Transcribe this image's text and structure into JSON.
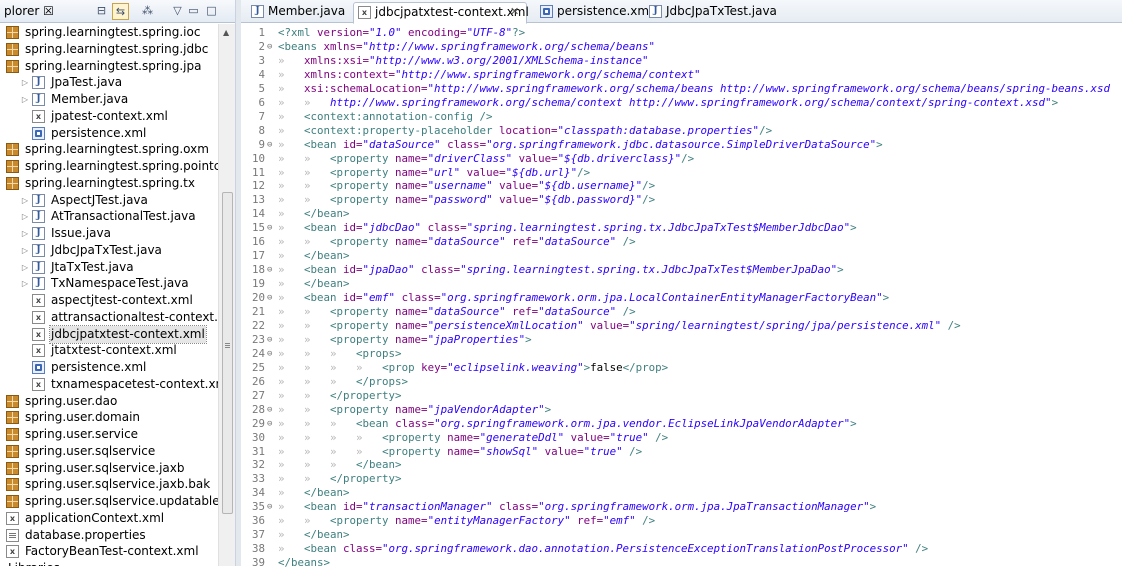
{
  "explorer": {
    "title": "plorer",
    "tree": [
      {
        "label": "spring.learningtest.spring.ioc",
        "type": "package",
        "twisty": ""
      },
      {
        "label": "spring.learningtest.spring.jdbc",
        "type": "package",
        "twisty": ""
      },
      {
        "label": "spring.learningtest.spring.jpa",
        "type": "package",
        "twisty": ""
      },
      {
        "label": "JpaTest.java",
        "type": "java",
        "twisty": "▷"
      },
      {
        "label": "Member.java",
        "type": "java",
        "twisty": "▷"
      },
      {
        "label": "jpatest-context.xml",
        "type": "xml",
        "twisty": ""
      },
      {
        "label": "persistence.xml",
        "type": "persistence",
        "twisty": ""
      },
      {
        "label": "spring.learningtest.spring.oxm",
        "type": "package",
        "twisty": ""
      },
      {
        "label": "spring.learningtest.spring.pointcut",
        "type": "package",
        "twisty": ""
      },
      {
        "label": "spring.learningtest.spring.tx",
        "type": "package",
        "twisty": ""
      },
      {
        "label": "AspectJTest.java",
        "type": "java",
        "twisty": "▷"
      },
      {
        "label": "AtTransactionalTest.java",
        "type": "java",
        "twisty": "▷"
      },
      {
        "label": "Issue.java",
        "type": "java",
        "twisty": "▷"
      },
      {
        "label": "JdbcJpaTxTest.java",
        "type": "java",
        "twisty": "▷"
      },
      {
        "label": "JtaTxTest.java",
        "type": "java",
        "twisty": "▷"
      },
      {
        "label": "TxNamespaceTest.java",
        "type": "java",
        "twisty": "▷"
      },
      {
        "label": "aspectjtest-context.xml",
        "type": "xml",
        "twisty": ""
      },
      {
        "label": "attransactionaltest-context.xml",
        "type": "xml",
        "twisty": ""
      },
      {
        "label": "jdbcjpatxtest-context.xml",
        "type": "xml",
        "twisty": "",
        "selected": true
      },
      {
        "label": "jtatxtest-context.xml",
        "type": "xml",
        "twisty": ""
      },
      {
        "label": "persistence.xml",
        "type": "persistence",
        "twisty": ""
      },
      {
        "label": "txnamespacetest-context.xml",
        "type": "xml",
        "twisty": ""
      },
      {
        "label": "spring.user.dao",
        "type": "package",
        "twisty": ""
      },
      {
        "label": "spring.user.domain",
        "type": "package",
        "twisty": ""
      },
      {
        "label": "spring.user.service",
        "type": "package",
        "twisty": ""
      },
      {
        "label": "spring.user.sqlservice",
        "type": "package",
        "twisty": ""
      },
      {
        "label": "spring.user.sqlservice.jaxb",
        "type": "package",
        "twisty": ""
      },
      {
        "label": "spring.user.sqlservice.jaxb.bak",
        "type": "package",
        "twisty": ""
      },
      {
        "label": "spring.user.sqlservice.updatable",
        "type": "package",
        "twisty": ""
      },
      {
        "label": "applicationContext.xml",
        "type": "xml",
        "twisty": ""
      },
      {
        "label": "database.properties",
        "type": "props",
        "twisty": ""
      },
      {
        "label": "FactoryBeanTest-context.xml",
        "type": "xml",
        "twisty": ""
      },
      {
        "label": "Libraries",
        "type": "none",
        "twisty": ""
      }
    ]
  },
  "editor": {
    "tabs": [
      {
        "label": "Member.java",
        "icon": "java",
        "active": false
      },
      {
        "label": "jdbcjpatxtest-context.xml",
        "icon": "xml",
        "active": true,
        "close": "✕"
      },
      {
        "label": "persistence.xml",
        "icon": "persistence",
        "active": false
      },
      {
        "label": "JdbcJpaTxTest.java",
        "icon": "java",
        "active": false
      }
    ],
    "lines": [
      {
        "n": "1",
        "fold": "",
        "indent": 0,
        "tokens": [
          [
            "pi",
            "<?xml"
          ],
          [
            "attr",
            " version="
          ],
          [
            "val",
            "\"1.0\""
          ],
          [
            "attr",
            " encoding="
          ],
          [
            "val",
            "\"UTF-8\""
          ],
          [
            "pi",
            "?>"
          ]
        ]
      },
      {
        "n": "2",
        "fold": "⊖",
        "indent": 0,
        "tokens": [
          [
            "tag",
            "<beans"
          ],
          [
            "attr",
            " xmlns="
          ],
          [
            "val",
            "\"http://www.springframework.org/schema/beans\""
          ]
        ]
      },
      {
        "n": "3",
        "fold": "",
        "indent": 1,
        "tokens": [
          [
            "attr",
            "xmlns:xsi="
          ],
          [
            "val",
            "\"http://www.w3.org/2001/XMLSchema-instance\""
          ]
        ]
      },
      {
        "n": "4",
        "fold": "",
        "indent": 1,
        "tokens": [
          [
            "attr",
            "xmlns:context="
          ],
          [
            "val",
            "\"http://www.springframework.org/schema/context\""
          ]
        ]
      },
      {
        "n": "5",
        "fold": "",
        "indent": 1,
        "tokens": [
          [
            "attr",
            "xsi:schemaLocation="
          ],
          [
            "val",
            "\"http://www.springframework.org/schema/beans http://www.springframework.org/schema/beans/spring-beans.xsd"
          ]
        ]
      },
      {
        "n": "6",
        "fold": "",
        "indent": 2,
        "tokens": [
          [
            "val",
            "http://www.springframework.org/schema/context http://www.springframework.org/schema/context/spring-context.xsd\""
          ],
          [
            "tag",
            ">"
          ]
        ]
      },
      {
        "n": "7",
        "fold": "",
        "indent": 1,
        "tokens": [
          [
            "tag",
            "<context:annotation-config"
          ],
          [
            "tag",
            " />"
          ]
        ]
      },
      {
        "n": "8",
        "fold": "",
        "indent": 1,
        "tokens": [
          [
            "tag",
            "<context:property-placeholder"
          ],
          [
            "attr",
            " location="
          ],
          [
            "val",
            "\"classpath:database.properties\""
          ],
          [
            "tag",
            "/>"
          ]
        ]
      },
      {
        "n": "9",
        "fold": "⊖",
        "indent": 1,
        "tokens": [
          [
            "tag",
            "<bean"
          ],
          [
            "attr",
            " id="
          ],
          [
            "val",
            "\"dataSource\""
          ],
          [
            "attr",
            " class="
          ],
          [
            "val",
            "\"org.springframework.jdbc.datasource.SimpleDriverDataSource\""
          ],
          [
            "tag",
            ">"
          ]
        ]
      },
      {
        "n": "10",
        "fold": "",
        "indent": 2,
        "tokens": [
          [
            "tag",
            "<property"
          ],
          [
            "attr",
            " name="
          ],
          [
            "val",
            "\"driverClass\""
          ],
          [
            "attr",
            " value="
          ],
          [
            "val",
            "\"${db.driverclass}\""
          ],
          [
            "tag",
            "/>"
          ]
        ]
      },
      {
        "n": "11",
        "fold": "",
        "indent": 2,
        "tokens": [
          [
            "tag",
            "<property"
          ],
          [
            "attr",
            " name="
          ],
          [
            "val",
            "\"url\""
          ],
          [
            "attr",
            " value="
          ],
          [
            "val",
            "\"${db.url}\""
          ],
          [
            "tag",
            "/>"
          ]
        ]
      },
      {
        "n": "12",
        "fold": "",
        "indent": 2,
        "tokens": [
          [
            "tag",
            "<property"
          ],
          [
            "attr",
            " name="
          ],
          [
            "val",
            "\"username\""
          ],
          [
            "attr",
            " value="
          ],
          [
            "val",
            "\"${db.username}\""
          ],
          [
            "tag",
            "/>"
          ]
        ]
      },
      {
        "n": "13",
        "fold": "",
        "indent": 2,
        "tokens": [
          [
            "tag",
            "<property"
          ],
          [
            "attr",
            " name="
          ],
          [
            "val",
            "\"password\""
          ],
          [
            "attr",
            " value="
          ],
          [
            "val",
            "\"${db.password}\""
          ],
          [
            "tag",
            "/>"
          ]
        ]
      },
      {
        "n": "14",
        "fold": "",
        "indent": 1,
        "tokens": [
          [
            "tag",
            "</bean>"
          ]
        ]
      },
      {
        "n": "15",
        "fold": "⊖",
        "indent": 1,
        "tokens": [
          [
            "tag",
            "<bean"
          ],
          [
            "attr",
            " id="
          ],
          [
            "val",
            "\"jdbcDao\""
          ],
          [
            "attr",
            " class="
          ],
          [
            "val",
            "\"spring.learningtest.spring.tx.JdbcJpaTxTest$MemberJdbcDao\""
          ],
          [
            "tag",
            ">"
          ]
        ]
      },
      {
        "n": "16",
        "fold": "",
        "indent": 2,
        "tokens": [
          [
            "tag",
            "<property"
          ],
          [
            "attr",
            " name="
          ],
          [
            "val",
            "\"dataSource\""
          ],
          [
            "attr",
            " ref="
          ],
          [
            "val",
            "\"dataSource\""
          ],
          [
            "tag",
            " />"
          ]
        ]
      },
      {
        "n": "17",
        "fold": "",
        "indent": 1,
        "tokens": [
          [
            "tag",
            "</bean>"
          ]
        ]
      },
      {
        "n": "18",
        "fold": "⊖",
        "indent": 1,
        "tokens": [
          [
            "tag",
            "<bean"
          ],
          [
            "attr",
            " id="
          ],
          [
            "val",
            "\"jpaDao\""
          ],
          [
            "attr",
            " class="
          ],
          [
            "val",
            "\"spring.learningtest.spring.tx.JdbcJpaTxTest$MemberJpaDao\""
          ],
          [
            "tag",
            ">"
          ]
        ]
      },
      {
        "n": "19",
        "fold": "",
        "indent": 1,
        "tokens": [
          [
            "tag",
            "</bean>"
          ]
        ]
      },
      {
        "n": "20",
        "fold": "⊖",
        "indent": 1,
        "tokens": [
          [
            "tag",
            "<bean"
          ],
          [
            "attr",
            " id="
          ],
          [
            "val",
            "\"emf\""
          ],
          [
            "attr",
            " class="
          ],
          [
            "val",
            "\"org.springframework.orm.jpa.LocalContainerEntityManagerFactoryBean\""
          ],
          [
            "tag",
            ">"
          ]
        ]
      },
      {
        "n": "21",
        "fold": "",
        "indent": 2,
        "tokens": [
          [
            "tag",
            "<property"
          ],
          [
            "attr",
            " name="
          ],
          [
            "val",
            "\"dataSource\""
          ],
          [
            "attr",
            " ref="
          ],
          [
            "val",
            "\"dataSource\""
          ],
          [
            "tag",
            " />"
          ]
        ]
      },
      {
        "n": "22",
        "fold": "",
        "indent": 2,
        "tokens": [
          [
            "tag",
            "<property"
          ],
          [
            "attr",
            " name="
          ],
          [
            "val",
            "\"persistenceXmlLocation\""
          ],
          [
            "attr",
            " value="
          ],
          [
            "val",
            "\"spring/learningtest/spring/jpa/persistence.xml\""
          ],
          [
            "tag",
            " />"
          ]
        ]
      },
      {
        "n": "23",
        "fold": "⊖",
        "indent": 2,
        "tokens": [
          [
            "tag",
            "<property"
          ],
          [
            "attr",
            " name="
          ],
          [
            "val",
            "\"jpaProperties\""
          ],
          [
            "tag",
            ">"
          ]
        ]
      },
      {
        "n": "24",
        "fold": "⊖",
        "indent": 3,
        "tokens": [
          [
            "tag",
            "<props>"
          ]
        ]
      },
      {
        "n": "25",
        "fold": "",
        "indent": 4,
        "tokens": [
          [
            "tag",
            "<prop"
          ],
          [
            "attr",
            " key="
          ],
          [
            "val",
            "\"eclipselink.weaving\""
          ],
          [
            "tag",
            ">"
          ],
          [
            "text",
            "false"
          ],
          [
            "tag",
            "</prop>"
          ]
        ]
      },
      {
        "n": "26",
        "fold": "",
        "indent": 3,
        "tokens": [
          [
            "tag",
            "</props>"
          ]
        ]
      },
      {
        "n": "27",
        "fold": "",
        "indent": 2,
        "tokens": [
          [
            "tag",
            "</property>"
          ]
        ]
      },
      {
        "n": "28",
        "fold": "⊖",
        "indent": 2,
        "tokens": [
          [
            "tag",
            "<property"
          ],
          [
            "attr",
            " name="
          ],
          [
            "val",
            "\"jpaVendorAdapter\""
          ],
          [
            "tag",
            ">"
          ]
        ]
      },
      {
        "n": "29",
        "fold": "⊖",
        "indent": 3,
        "tokens": [
          [
            "tag",
            "<bean"
          ],
          [
            "attr",
            " class="
          ],
          [
            "val",
            "\"org.springframework.orm.jpa.vendor.EclipseLinkJpaVendorAdapter\""
          ],
          [
            "tag",
            ">"
          ]
        ]
      },
      {
        "n": "30",
        "fold": "",
        "indent": 4,
        "tokens": [
          [
            "tag",
            "<property"
          ],
          [
            "attr",
            " name="
          ],
          [
            "val",
            "\"generateDdl\""
          ],
          [
            "attr",
            " value="
          ],
          [
            "val",
            "\"true\""
          ],
          [
            "tag",
            " />"
          ]
        ]
      },
      {
        "n": "31",
        "fold": "",
        "indent": 4,
        "tokens": [
          [
            "tag",
            "<property"
          ],
          [
            "attr",
            " name="
          ],
          [
            "val",
            "\"showSql\""
          ],
          [
            "attr",
            " value="
          ],
          [
            "val",
            "\"true\""
          ],
          [
            "tag",
            " />"
          ]
        ]
      },
      {
        "n": "32",
        "fold": "",
        "indent": 3,
        "tokens": [
          [
            "tag",
            "</bean>"
          ]
        ]
      },
      {
        "n": "33",
        "fold": "",
        "indent": 2,
        "tokens": [
          [
            "tag",
            "</property>"
          ]
        ]
      },
      {
        "n": "34",
        "fold": "",
        "indent": 1,
        "tokens": [
          [
            "tag",
            "</bean>"
          ]
        ]
      },
      {
        "n": "35",
        "fold": "⊖",
        "indent": 1,
        "tokens": [
          [
            "tag",
            "<bean"
          ],
          [
            "attr",
            " id="
          ],
          [
            "val",
            "\"transactionManager\""
          ],
          [
            "attr",
            " class="
          ],
          [
            "val",
            "\"org.springframework.orm.jpa.JpaTransactionManager\""
          ],
          [
            "tag",
            ">"
          ]
        ]
      },
      {
        "n": "36",
        "fold": "",
        "indent": 2,
        "tokens": [
          [
            "tag",
            "<property"
          ],
          [
            "attr",
            " name="
          ],
          [
            "val",
            "\"entityManagerFactory\""
          ],
          [
            "attr",
            " ref="
          ],
          [
            "val",
            "\"emf\""
          ],
          [
            "tag",
            " />"
          ]
        ]
      },
      {
        "n": "37",
        "fold": "",
        "indent": 1,
        "tokens": [
          [
            "tag",
            "</bean>"
          ]
        ]
      },
      {
        "n": "38",
        "fold": "",
        "indent": 1,
        "tokens": [
          [
            "tag",
            "<bean"
          ],
          [
            "attr",
            " class="
          ],
          [
            "val",
            "\"org.springframework.dao.annotation.PersistenceExceptionTranslationPostProcessor\""
          ],
          [
            "tag",
            " />"
          ]
        ]
      },
      {
        "n": "39",
        "fold": "",
        "indent": 0,
        "tokens": [
          [
            "tag",
            "</beans>"
          ]
        ]
      }
    ]
  },
  "colors": {
    "tag": "#3f7f7f",
    "attr": "#7f007f",
    "value": "#2a00ff",
    "selection": "#e6e6e6"
  }
}
